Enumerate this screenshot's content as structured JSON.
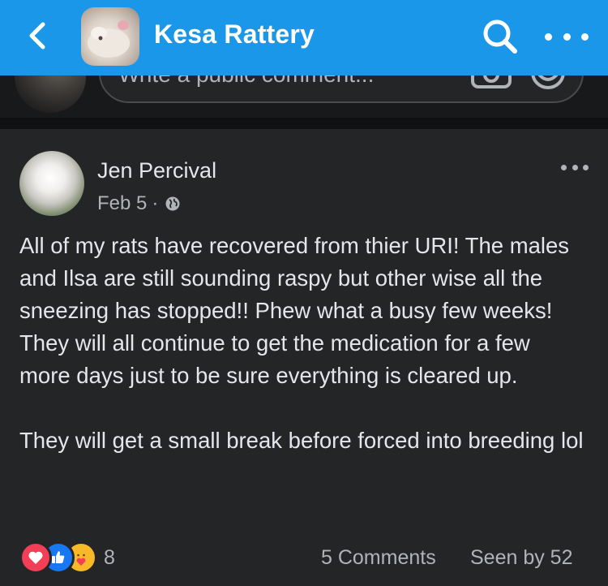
{
  "header": {
    "group_name": "Kesa Rattery",
    "back_icon": "chevron-left-icon",
    "search_icon": "search-icon",
    "more_icon": "more-horizontal-icon",
    "background_color": "#1a97e8"
  },
  "composer": {
    "placeholder": "Write a public comment...",
    "camera_icon": "camera-icon",
    "emoji_icon": "emoji-icon"
  },
  "post": {
    "author": "Jen Percival",
    "date": "Feb 5",
    "separator": "·",
    "audience_icon": "globe-icon",
    "paragraphs": [
      "All of my rats have recovered from thier URI! The males and Ilsa are still sounding raspy but other wise all the sneezing has stopped!! Phew what a busy few weeks! They will all continue to get the medication for a few more days just to be sure everything is cleared up.",
      "They will get a small break before forced into breeding lol"
    ]
  },
  "footer": {
    "reaction_types": [
      "love",
      "like",
      "care"
    ],
    "reaction_count": "8",
    "comments": "5 Comments",
    "seen_by": "Seen by 52"
  }
}
